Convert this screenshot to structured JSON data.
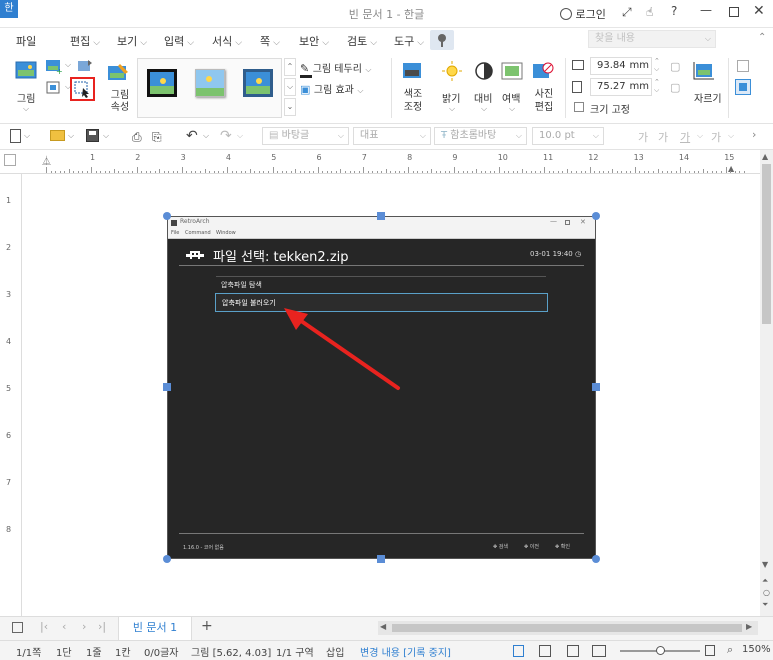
{
  "window": {
    "title": "빈 문서 1 - 한글",
    "app_icon": "한",
    "login": "로그인"
  },
  "menus": [
    "파일",
    "편집",
    "보기",
    "입력",
    "서식",
    "쪽",
    "보안",
    "검토",
    "도구"
  ],
  "ribbon": {
    "picture_label": "그림",
    "picture_props_label": "그림 속성",
    "picture_border": "그림 테두리",
    "picture_effect": "그림 효과",
    "color_adjust": "색조 조정",
    "brightness": "밝기",
    "contrast": "대비",
    "margin": "여백",
    "photo_edit": "사진 편집",
    "width_value": "93.84",
    "height_value": "75.27",
    "unit": "mm",
    "fix_size": "크기 고정",
    "crop": "자르기",
    "search_placeholder": "찾을 내용"
  },
  "toolbar2": {
    "style": "바탕글",
    "outline": "대표",
    "font": "함초롬바탕",
    "size": "10.0",
    "size_unit": "pt"
  },
  "ruler_numbers": [
    "1",
    "2",
    "3",
    "4",
    "5",
    "6",
    "7",
    "8",
    "9",
    "10",
    "11",
    "12",
    "13",
    "14",
    "15"
  ],
  "vruler_numbers": [
    "1",
    "2",
    "3",
    "4",
    "5",
    "6",
    "7",
    "8"
  ],
  "embedded": {
    "app_name": "RetroArch",
    "menu": [
      "File",
      "Command",
      "Window"
    ],
    "heading": "파일 선택: tekken2.zip",
    "clock": "03-01 19:40",
    "items": [
      "압축파일 탐색",
      "압축파일 불러오기"
    ],
    "selected_index": 1,
    "version": "1.16.0 - 코어 없음",
    "footer_actions": [
      "검색",
      "이전",
      "확인"
    ]
  },
  "tabbar": {
    "doc_tab": "빈 문서 1"
  },
  "status": {
    "page": "1/1쪽",
    "column": "1단",
    "line": "1줄",
    "col": "1칸",
    "chars": "0/0글자",
    "object": "그림 [5.62, 4.03]",
    "section": "1/1 구역",
    "mode": "삽입",
    "track": "변경 내용 [기록 중지]",
    "zoom": "150%"
  },
  "colors": {
    "accent": "#2f7fd0",
    "annotation": "#e8231f",
    "selection_handle": "#5b8dd6"
  }
}
